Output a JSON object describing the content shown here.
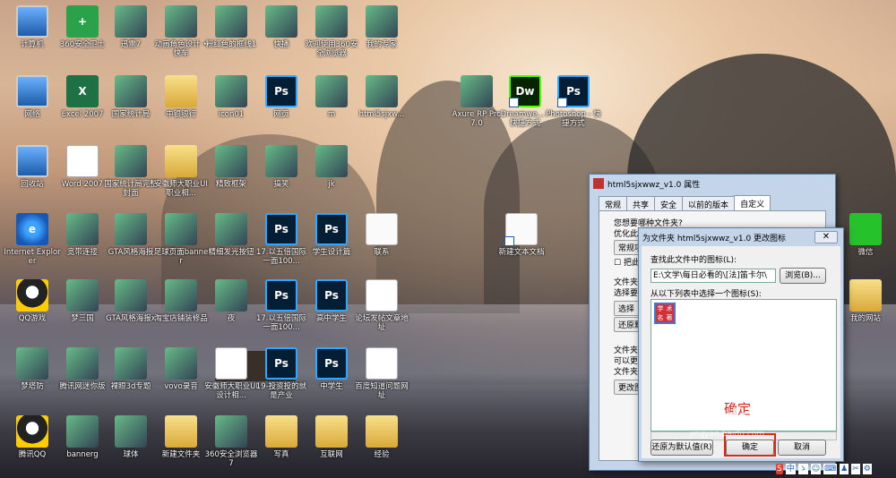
{
  "desktop": {
    "icons": [
      {
        "label": "计算机",
        "icon": "computer-icon"
      },
      {
        "label": "360安全卫士",
        "icon": "360-security-icon"
      },
      {
        "label": "迅雷7",
        "icon": "thunder-icon"
      },
      {
        "label": "动画角色设计 • 快车",
        "icon": "image-icon"
      },
      {
        "label": "粉红色的框线1",
        "icon": "image-icon"
      },
      {
        "label": "快播",
        "icon": "qvod-icon"
      },
      {
        "label": "欢迎使用360安全浏览器",
        "icon": "360-browser-icon"
      },
      {
        "label": "我的专家",
        "icon": "doctor-icon"
      },
      {
        "label": "网络",
        "icon": "network-icon"
      },
      {
        "label": "Excel 2007",
        "icon": "excel-icon"
      },
      {
        "label": "国家统计局",
        "icon": "image-icon"
      },
      {
        "label": "中银银行",
        "icon": "folder-icon"
      },
      {
        "label": "icon01",
        "icon": "image-icon"
      },
      {
        "label": "网页",
        "icon": "photoshop-icon"
      },
      {
        "label": "m",
        "icon": "image-icon"
      },
      {
        "label": "html5sjxw...",
        "icon": "winrar-icon"
      },
      {
        "label": "回收站",
        "icon": "recycle-bin-icon"
      },
      {
        "label": "Word 2007",
        "icon": "word-icon"
      },
      {
        "label": "国家统计局完整封面",
        "icon": "image-icon"
      },
      {
        "label": "安徽师大职业UI职业相...",
        "icon": "folder-icon"
      },
      {
        "label": "精致框架",
        "icon": "image-icon"
      },
      {
        "label": "搞笑",
        "icon": "image-icon"
      },
      {
        "label": "jk",
        "icon": "image-icon"
      },
      {
        "label": "Internet Explorer",
        "icon": "internet-explorer-icon"
      },
      {
        "label": "宽带连接",
        "icon": "broadband-icon"
      },
      {
        "label": "GTA风格海报",
        "icon": "image-icon"
      },
      {
        "label": "足球页面banner",
        "icon": "image-icon"
      },
      {
        "label": "精细发光按钮",
        "icon": "image-icon"
      },
      {
        "label": "17.以五倍国际一面100...",
        "icon": "photoshop-icon"
      },
      {
        "label": "学生设计篇",
        "icon": "photoshop-icon"
      },
      {
        "label": "联系",
        "icon": "text-document-icon"
      },
      {
        "label": "QQ游戏",
        "icon": "qq-game-icon"
      },
      {
        "label": "梦三国",
        "icon": "game-icon"
      },
      {
        "label": "GTA风格海报x",
        "icon": "image-icon"
      },
      {
        "label": "淘宝店铺装修品",
        "icon": "image-icon"
      },
      {
        "label": "夜",
        "icon": "image-icon"
      },
      {
        "label": "17.以五倍国际一面100...",
        "icon": "photoshop-icon"
      },
      {
        "label": "高中学生",
        "icon": "photoshop-icon"
      },
      {
        "label": "论坛发帖文章地址",
        "icon": "word-icon"
      },
      {
        "label": "梦塔防",
        "icon": "game-icon"
      },
      {
        "label": "腾讯网迷你版",
        "icon": "tencent-icon"
      },
      {
        "label": "裸眼3d专题",
        "icon": "image-icon"
      },
      {
        "label": "vovo录音",
        "icon": "image-icon"
      },
      {
        "label": "安徽师大职业UI设计相...",
        "icon": "word-icon"
      },
      {
        "label": "19-投资投的就是产业",
        "icon": "photoshop-icon"
      },
      {
        "label": "中学生",
        "icon": "photoshop-icon"
      },
      {
        "label": "百度知道问题网址",
        "icon": "word-icon"
      },
      {
        "label": "腾讯QQ",
        "icon": "qq-icon"
      },
      {
        "label": "bannerg",
        "icon": "image-icon"
      },
      {
        "label": "球体",
        "icon": "image-icon"
      },
      {
        "label": "新建文件夹",
        "icon": "folder-icon"
      },
      {
        "label": "360安全浏览器7",
        "icon": "360-browser-icon"
      },
      {
        "label": "写真",
        "icon": "folder-icon"
      },
      {
        "label": "互联网",
        "icon": "folder-icon"
      },
      {
        "label": "经验",
        "icon": "folder-icon"
      },
      {
        "label": "Axure RP Pro 7.0",
        "icon": "axure-icon"
      },
      {
        "label": "Dreamwe... - 快捷方式",
        "icon": "dreamweaver-icon"
      },
      {
        "label": "Photoshop - 快捷方式",
        "icon": "photoshop-icon"
      },
      {
        "label": "新建文本文档",
        "icon": "text-document-icon"
      },
      {
        "label": "微信",
        "icon": "wechat-icon"
      },
      {
        "label": "我的网站",
        "icon": "folder-icon"
      }
    ]
  },
  "properties_dialog": {
    "title": "html5sjxwwz_v1.0 属性",
    "tabs": [
      "常规",
      "共享",
      "安全",
      "以前的版本",
      "自定义"
    ],
    "active_tab": "自定义",
    "text_what_kind": "您想要哪种文件夹?",
    "text_optimize": "优化此",
    "select_value": "常规项",
    "checkbox_label": "把此",
    "text_folder_pic": "文件夹",
    "text_choose": "选择要",
    "btn_choose": "选择",
    "btn_restore": "还原默",
    "text_folder_icon": "文件夹",
    "text_can_modify": "可以更",
    "text_file_icon": "文件夹",
    "btn_change": "更改图"
  },
  "change_icon_dialog": {
    "title": "为文件夹 html5sjxwwz_v1.0 更改图标",
    "close_label": "✕",
    "find_label": "查找此文件中的图标(L):",
    "path_value": "E:\\文学\\每日必看的\\[法]笛卡尔\\",
    "browse_button": "浏览(B)...",
    "list_label": "从以下列表中选择一个图标(S):",
    "selected_icon_chars": [
      "学",
      "术",
      "名",
      "著"
    ],
    "restore_default_button": "还原为默认值(R)",
    "ok_button": "确定",
    "cancel_button": "取消"
  },
  "annotation": {
    "red_text": "确定"
  },
  "watermark": {
    "brand": "Baidu经验",
    "url": "jingyan.baidu.com"
  },
  "tray": {
    "items": [
      "S",
      "中",
      "ゝ",
      "☺",
      "⌨",
      "♟",
      "✂",
      "⚙"
    ]
  }
}
